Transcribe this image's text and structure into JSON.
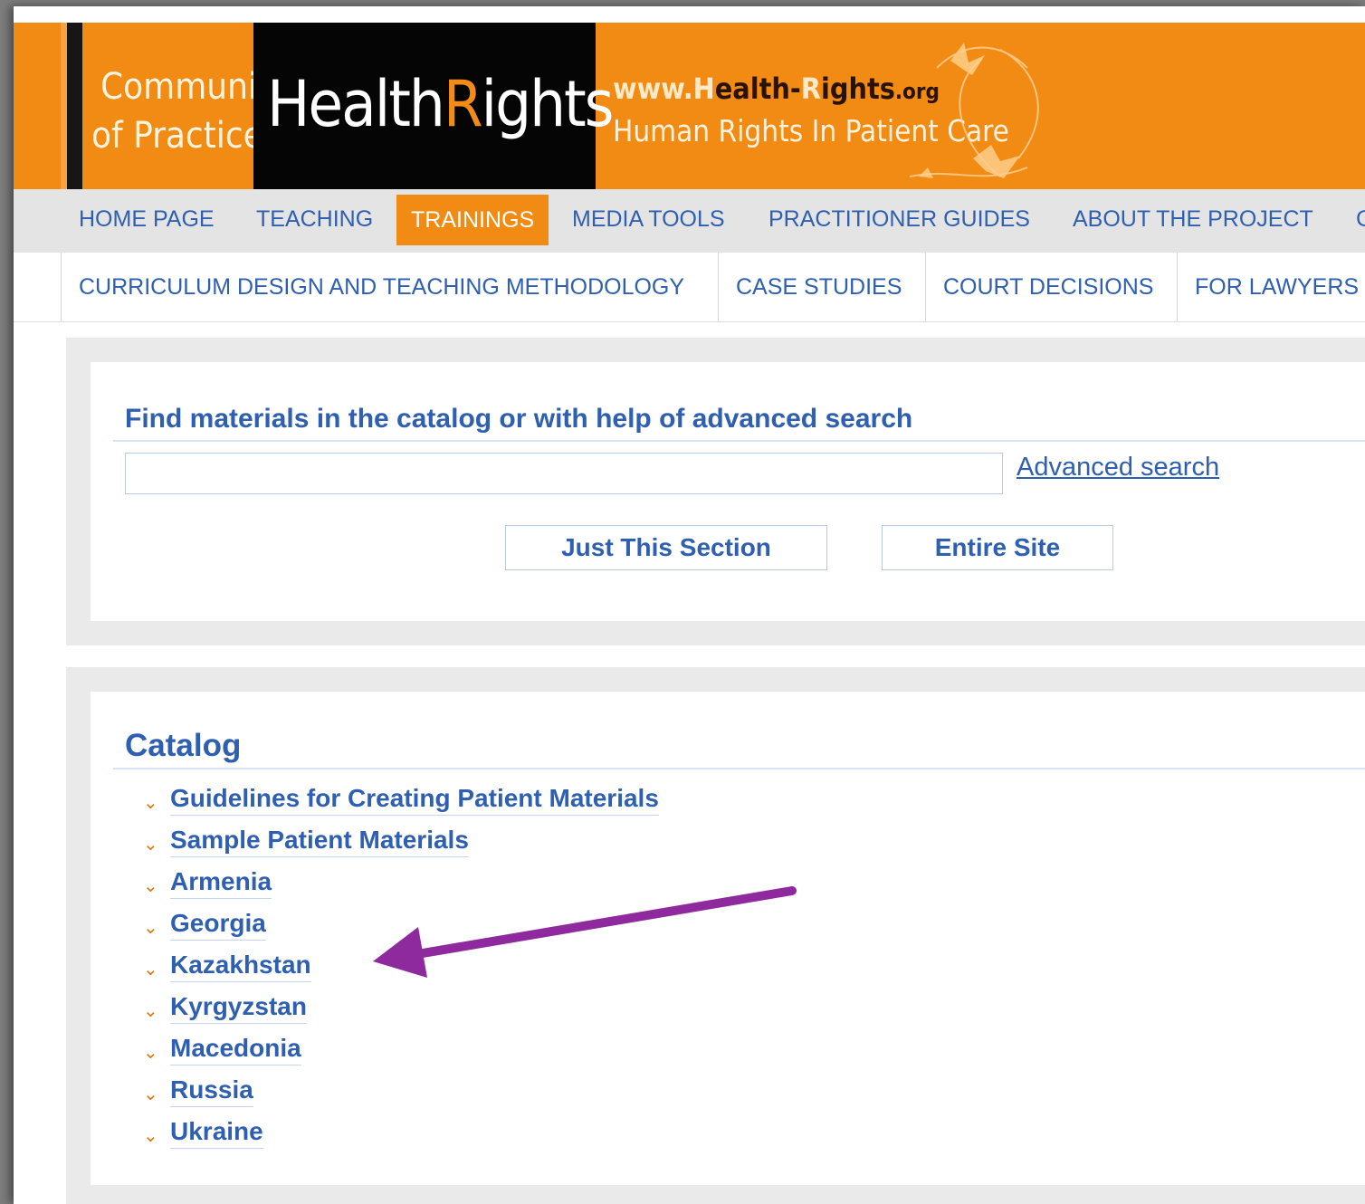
{
  "header": {
    "community_line1": "Community",
    "community_line2": "of Practice",
    "logo_part1": "Health",
    "logo_part2": "R",
    "logo_part3": "ights",
    "url_prefix": "www.",
    "url_h": "H",
    "url_mid": "ealth-",
    "url_r": "R",
    "url_end": "ights",
    "url_tld": ".org",
    "tagline": "Human Rights In Patient Care",
    "brand_color": "#f18b14"
  },
  "nav_primary": [
    {
      "label": "HOME PAGE"
    },
    {
      "label": "TEACHING"
    },
    {
      "label": "TRAININGS"
    },
    {
      "label": "MEDIA TOOLS"
    },
    {
      "label": "PRACTITIONER GUIDES"
    },
    {
      "label": "ABOUT THE PROJECT"
    },
    {
      "label": "C"
    }
  ],
  "nav_secondary": [
    {
      "label": "CURRICULUM DESIGN AND TEACHING METHODOLOGY"
    },
    {
      "label": "CASE STUDIES"
    },
    {
      "label": "COURT DECISIONS"
    },
    {
      "label": "FOR LAWYERS"
    }
  ],
  "search": {
    "title": "Find materials in the catalog or with help of advanced search",
    "input_value": "",
    "advanced_label": "Advanced search",
    "btn_section": "Just This Section",
    "btn_site": "Entire Site"
  },
  "catalog": {
    "title": "Catalog",
    "items": [
      {
        "label": "Guidelines for Creating Patient Materials"
      },
      {
        "label": "Sample Patient Materials"
      },
      {
        "label": "Armenia"
      },
      {
        "label": "Georgia"
      },
      {
        "label": "Kazakhstan"
      },
      {
        "label": "Kyrgyzstan"
      },
      {
        "label": "Macedonia"
      },
      {
        "label": "Russia"
      },
      {
        "label": "Ukraine"
      }
    ]
  },
  "annotation": {
    "arrow_color": "#8e2a9e"
  }
}
